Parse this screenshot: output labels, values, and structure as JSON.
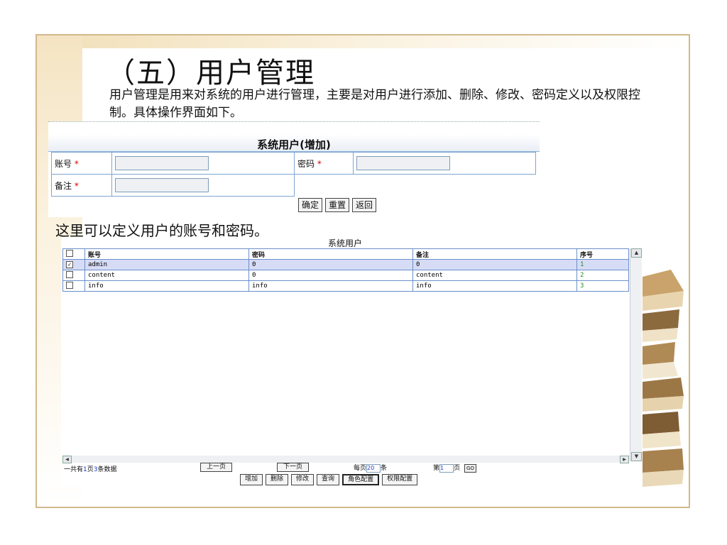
{
  "slide": {
    "title": "（五）用户管理",
    "description": "用户管理是用来对系统的用户进行管理，主要是对用户进行添加、删除、修改、密码定义以及权限控制。具体操作界面如下。",
    "caption": "这里可以定义用户的账号和密码。"
  },
  "add_form": {
    "title": "系统用户(增加)",
    "account_label": "账号",
    "password_label": "密码",
    "remark_label": "备注",
    "required_mark": "*",
    "buttons": {
      "confirm": "确定",
      "reset": "重置",
      "back": "返回"
    }
  },
  "user_list": {
    "title": "系统用户",
    "columns": [
      "账号",
      "密码",
      "备注",
      "序号"
    ],
    "rows": [
      {
        "account": "admin",
        "password": "0",
        "remark": "0",
        "seq": "1",
        "checked": true
      },
      {
        "account": "content",
        "password": "0",
        "remark": "content",
        "seq": "2",
        "checked": false
      },
      {
        "account": "info",
        "password": "info",
        "remark": "info",
        "seq": "3",
        "checked": false
      }
    ],
    "pager": {
      "total_prefix": "一共有",
      "total_pages": "1",
      "pages_unit": "页",
      "total_records": "3",
      "records_unit": "条数据",
      "prev": "上一页",
      "next": "下一页",
      "per_page_prefix": "每页",
      "per_page": "20",
      "per_page_unit": "条",
      "page_prefix": "第",
      "page": "1",
      "page_unit": "页",
      "go": "GO"
    },
    "actions": {
      "add": "增加",
      "delete": "删除",
      "edit": "修改",
      "query": "查询",
      "role": "角色配置",
      "permission": "权限配置"
    },
    "check_mark": "✓"
  },
  "icons": {
    "up": "▲",
    "down": "▼",
    "left": "◀",
    "right": "▶"
  }
}
